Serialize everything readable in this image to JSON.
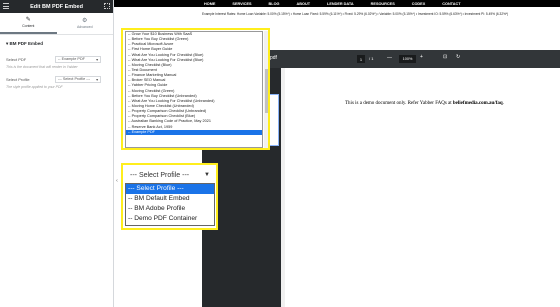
{
  "panel": {
    "title": "Edit BM PDF Embed",
    "tabs": [
      {
        "label": "Content",
        "icon": "pencil-icon"
      },
      {
        "label": "Advanced",
        "icon": "gear-icon"
      }
    ],
    "section_title": "BM PDF Embed",
    "select_pdf": {
      "label": "Select PDF",
      "value": "-- Example PDF",
      "help": "This is the document that will render in Yabber"
    },
    "select_profile": {
      "label": "Select Profile",
      "value": "--- Select Profile ---",
      "help": "The style profile applied to your PDF"
    }
  },
  "nav": {
    "items": [
      "HOME",
      "SERVICES",
      "BLOG",
      "ABOUT",
      "LENDER DATA",
      "RESOURCES",
      "CODEX",
      "CONTACT"
    ],
    "rates": "Example Interest Rates: Home Loan Variable: 5.00% (5.15%*) • Home Loan Fixed: 5.59% (6.11%*) • Fixed: 5.29% (6.02%*) • Variable: 5.00% (5.15%*) • Investment IO: 5.59% (6.63%*) • Investment PI: 5.49% (6.32%*)"
  },
  "pdf_viewer": {
    "title": "pdf",
    "page_current": "1",
    "page_total": "/ 1",
    "zoom_out": "—",
    "zoom": "100%",
    "zoom_in": "+",
    "fit_icon": "fit-page-icon",
    "rotate_icon": "rotate-icon",
    "page_text_before": "This is a demo document only. Refer Yabber FAQs at ",
    "page_text_link": "beliefmedia.com.au/faq",
    "page_text_after": "."
  },
  "pdf_dropdown": {
    "options": [
      "-- Grow Your $10 Business With SaaS",
      "-- Before You Buy Checklist (Green)",
      "-- Practical Microsoft Azure",
      "-- First Home Buyer Guide",
      "-- What Are You Looking For Checklist (Blue)",
      "-- What Are You Looking For Checklist (Blue)",
      "-- Moving Checklist (Blue)",
      "-- Test Document",
      "-- Finance Marketing Manual",
      "-- Broker SEO Manual",
      "-- Yabber Pricing Guide",
      "-- Moving Checklist (Green)",
      "-- Before You Buy Checklist (Unbranded)",
      "-- What Are You Looking For Checklist (Unbranded)",
      "-- Moving Home Checklist (Unbranded)",
      "-- Property Comparison Checklist (Unbranded)",
      "-- Property Comparison Checklist (Blue)",
      "-- Australian Banking Code of Practice, May 2021",
      "-- Reserve Bank Act, 1959",
      "-- Example PDF"
    ],
    "selected_index": 19
  },
  "profile_dropdown": {
    "closed_value": "--- Select Profile ---",
    "options": [
      "--- Select Profile ---",
      "-- BM Default Embed",
      "-- BM Adobe Profile",
      "-- Demo PDF Container"
    ],
    "selected_index": 0
  },
  "colors": {
    "highlight": "#ffee1c",
    "selection": "#1a73e8",
    "panel_header": "#26292c",
    "viewer_bar": "#323639"
  }
}
